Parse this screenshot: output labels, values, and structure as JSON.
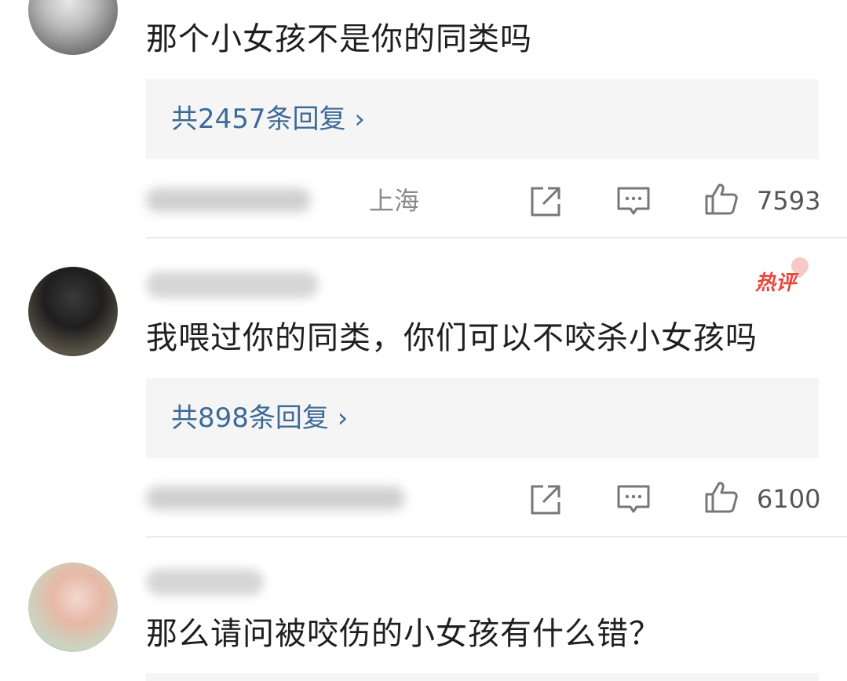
{
  "comments": [
    {
      "text": "那个小女孩不是你的同类吗",
      "reply_label": "共2457条回复 ›",
      "location": "上海",
      "likes": "7593",
      "hot": ""
    },
    {
      "text": "我喂过你的同类，你们可以不咬杀小女孩吗",
      "reply_label": "共898条回复 ›",
      "location": "",
      "likes": "6100",
      "hot": "热评"
    },
    {
      "text": "那么请问被咬伤的小女孩有什么错？",
      "reply_label": "",
      "location": "",
      "likes": "",
      "hot": ""
    }
  ],
  "icons": {
    "share": "share-icon",
    "reply": "comment-icon",
    "like": "thumbs-up-icon"
  },
  "colors": {
    "link": "#3d6a96",
    "hot_badge": "#e8463c",
    "reply_bg": "#f5f5f5"
  }
}
